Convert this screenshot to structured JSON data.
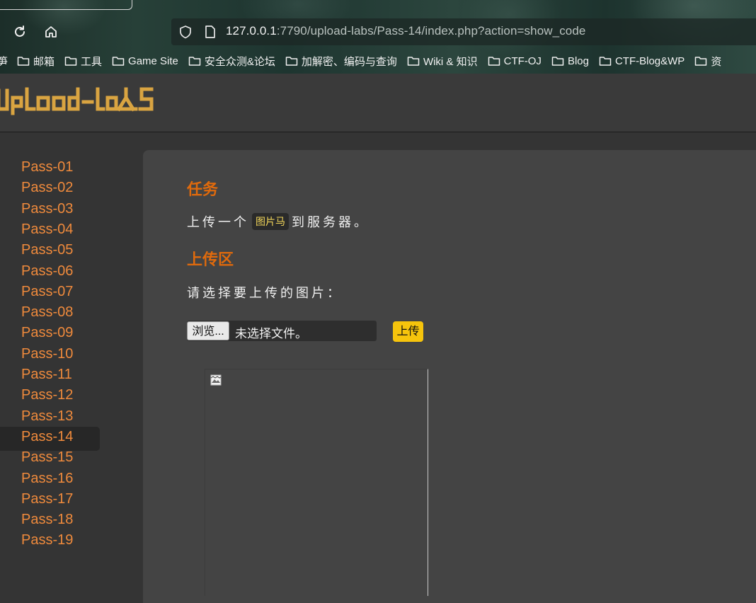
{
  "browser": {
    "url_host": "127.0.0.1",
    "url_rest": ":7790/upload-labs/Pass-14/index.php?action=show_code",
    "bookmarks": [
      {
        "label": "邮箱"
      },
      {
        "label": "工具"
      },
      {
        "label": "Game Site"
      },
      {
        "label": "安全众测&论坛"
      },
      {
        "label": "加解密、编码与查询"
      },
      {
        "label": "Wiki & 知识"
      },
      {
        "label": "CTF-OJ"
      },
      {
        "label": "Blog"
      },
      {
        "label": "CTF-Blog&WP"
      },
      {
        "label": "资"
      }
    ],
    "bookmark_cut_left": "笋"
  },
  "site": {
    "logo_text": "Upload-labs",
    "logo_color": "#d9a441"
  },
  "sidebar": {
    "active_index": 13,
    "items": [
      {
        "label": "Pass-01"
      },
      {
        "label": "Pass-02"
      },
      {
        "label": "Pass-03"
      },
      {
        "label": "Pass-04"
      },
      {
        "label": "Pass-05"
      },
      {
        "label": "Pass-06"
      },
      {
        "label": "Pass-07"
      },
      {
        "label": "Pass-08"
      },
      {
        "label": "Pass-09"
      },
      {
        "label": "Pass-10"
      },
      {
        "label": "Pass-11"
      },
      {
        "label": "Pass-12"
      },
      {
        "label": "Pass-13"
      },
      {
        "label": "Pass-14"
      },
      {
        "label": "Pass-15"
      },
      {
        "label": "Pass-16"
      },
      {
        "label": "Pass-17"
      },
      {
        "label": "Pass-18"
      },
      {
        "label": "Pass-19"
      }
    ]
  },
  "main": {
    "task_heading": "任务",
    "task_prefix": "上传一个",
    "task_code": "图片马",
    "task_suffix": "到服务器。",
    "upload_heading": "上传区",
    "select_label": "请选择要上传的图片：",
    "browse_label": "浏览...",
    "no_file_label": "未选择文件。",
    "upload_button": "上传"
  },
  "colors": {
    "accent_orange": "#e06a0c",
    "link_orange": "#ef8a3c",
    "upload_yellow": "#f6c40c",
    "panel_bg": "#444444"
  }
}
